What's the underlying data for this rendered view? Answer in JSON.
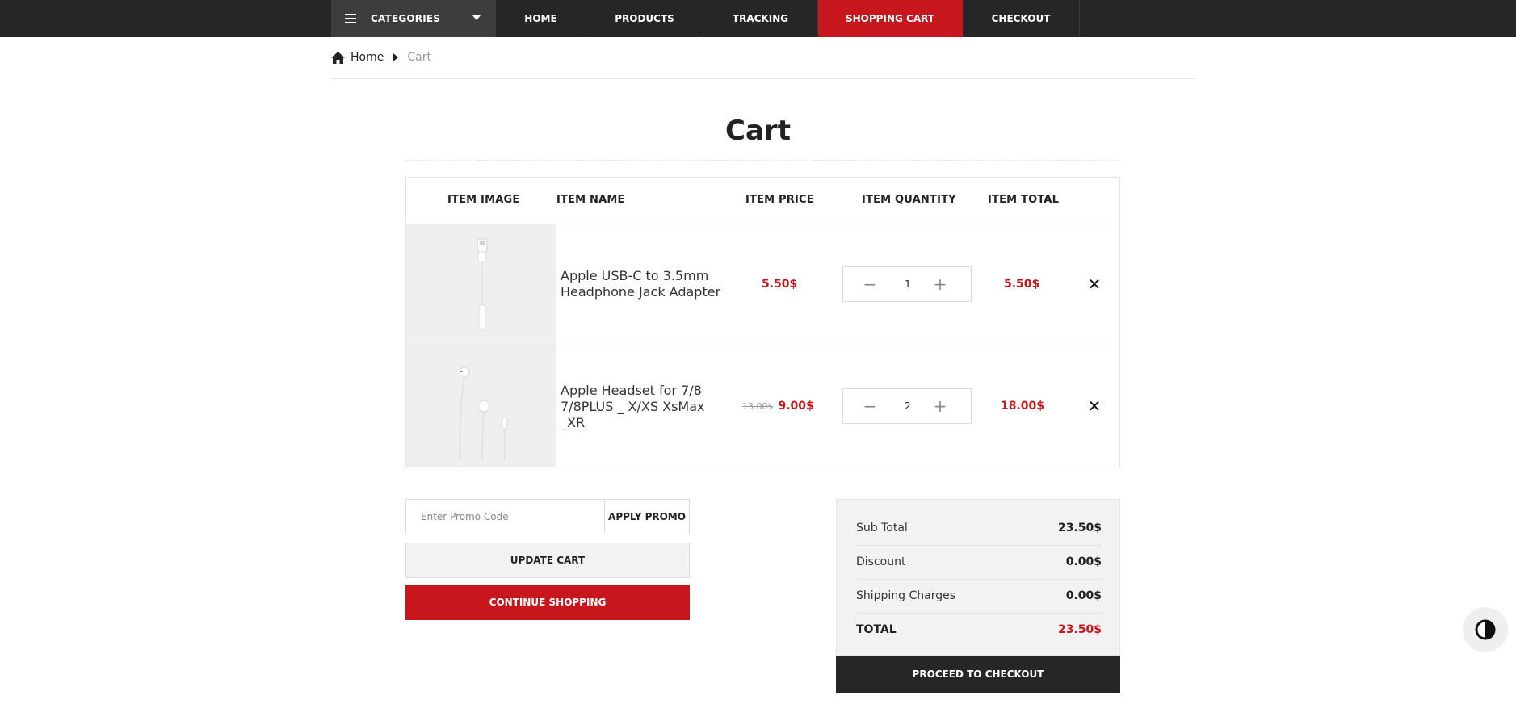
{
  "nav": {
    "categories_label": "CATEGORIES",
    "links": [
      "HOME",
      "PRODUCTS",
      "TRACKING",
      "SHOPPING CART",
      "CHECKOUT"
    ],
    "active": "SHOPPING CART"
  },
  "breadcrumb": {
    "home": "Home",
    "current": "Cart"
  },
  "page_title": "Cart",
  "table": {
    "headers": [
      "ITEM IMAGE",
      "ITEM NAME",
      "ITEM PRICE",
      "ITEM QUANTITY",
      "ITEM TOTAL"
    ],
    "rows": [
      {
        "name": "Apple USB-C to 3.5mm Headphone Jack Adapter",
        "old_price": "",
        "price": "5.50$",
        "quantity": "1",
        "total": "5.50$"
      },
      {
        "name": "Apple Headset for 7/8 7/8PLUS _ X/XS XsMax _XR",
        "old_price": "13.00$",
        "price": "9.00$",
        "quantity": "2",
        "total": "18.00$"
      }
    ]
  },
  "promo": {
    "placeholder": "Enter Promo Code",
    "button": "APPLY PROMO"
  },
  "buttons": {
    "update": "UPDATE CART",
    "continue": "CONTINUE SHOPPING",
    "checkout": "PROCEED TO CHECKOUT"
  },
  "summary": {
    "subtotal_label": "Sub Total",
    "subtotal": "23.50$",
    "discount_label": "Discount",
    "discount": "0.00$",
    "shipping_label": "Shipping Charges",
    "shipping": "0.00$",
    "total_label": "TOTAL",
    "total": "23.50$"
  },
  "icons": {
    "menu": "hamburger-icon",
    "caret": "caret-down-icon",
    "home": "home-icon",
    "separator": "caret-right-icon",
    "minus": "minus-icon",
    "plus": "plus-icon",
    "remove": "close-icon",
    "contrast": "contrast-icon"
  },
  "colors": {
    "accent": "#c8161d",
    "nav_bg": "#262626",
    "summary_bg": "#f2f2f2"
  }
}
